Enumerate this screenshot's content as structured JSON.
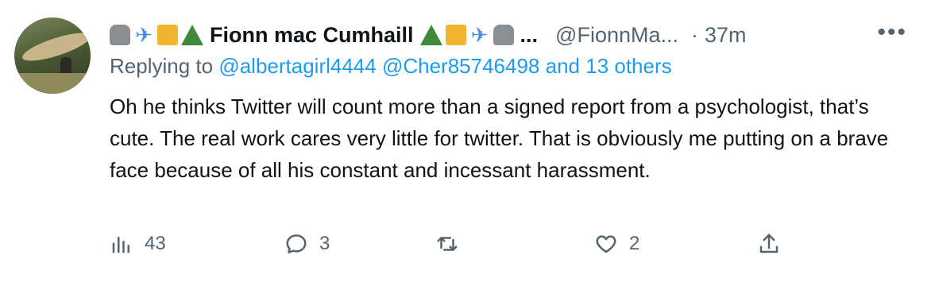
{
  "author": {
    "name": "Fionn mac Cumhaill",
    "handle": "@FionnMa...",
    "ellipsis": "...",
    "timestamp": "37m",
    "dot": "·",
    "more_label": "•••"
  },
  "replying": {
    "prefix": "Replying to",
    "mentions": [
      "@albertagirl4444",
      "@Cher85746498"
    ],
    "others": "and 13 others"
  },
  "body": {
    "text": "Oh he thinks Twitter will count more than a signed report from a psychologist, that’s cute. The real work cares very little for twitter. That is obviously me putting on a brave face because of all his constant and incessant harassment."
  },
  "actions": {
    "views": "43",
    "replies": "3",
    "retweets": "",
    "likes": "2"
  },
  "colors": {
    "link": "#1d9bf0",
    "muted": "#536471",
    "text": "#0f1419"
  }
}
